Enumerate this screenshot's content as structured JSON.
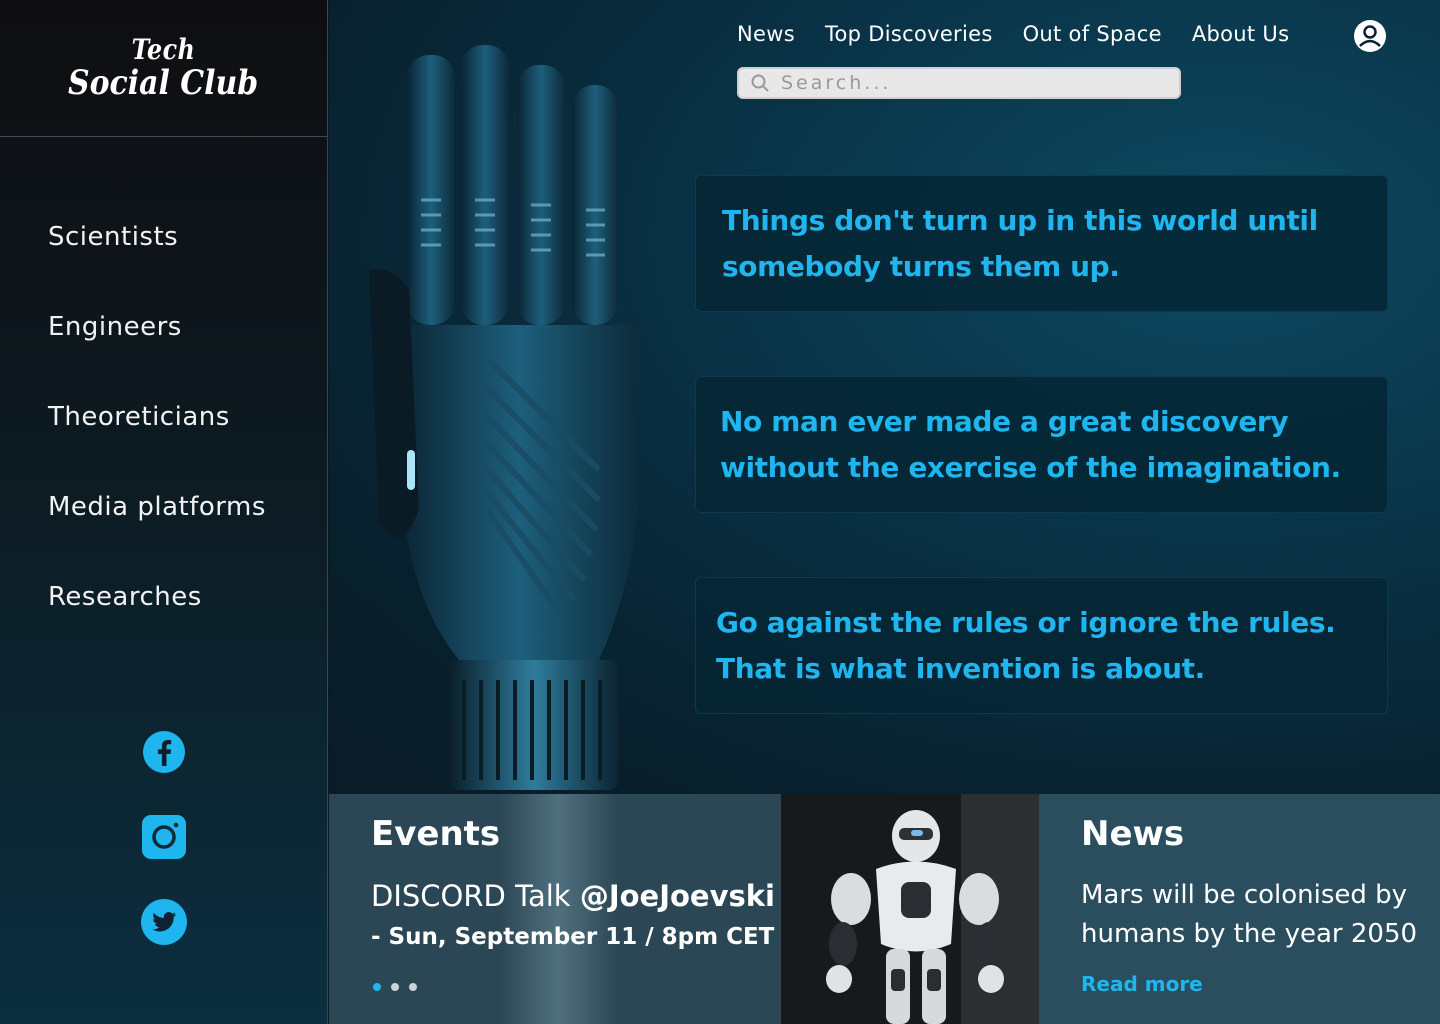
{
  "brand": {
    "line1": "Tech",
    "line2": "Social Club"
  },
  "sidebar": {
    "items": [
      {
        "label": "Scientists"
      },
      {
        "label": "Engineers"
      },
      {
        "label": "Theoreticians"
      },
      {
        "label": "Media platforms"
      },
      {
        "label": "Researches"
      }
    ],
    "socials": [
      "facebook-icon",
      "instagram-icon",
      "twitter-icon"
    ]
  },
  "topnav": {
    "items": [
      {
        "label": "News"
      },
      {
        "label": "Top Discoveries"
      },
      {
        "label": "Out of Space"
      },
      {
        "label": "About Us"
      }
    ]
  },
  "search": {
    "placeholder": "Search..."
  },
  "quotes": [
    {
      "text": "Things don't turn up in this world until somebody turns them up."
    },
    {
      "text": "No man ever made a great discovery without the exercise of the imagination."
    },
    {
      "text": "Go against the rules or ignore the rules. That is what invention is about."
    }
  ],
  "events": {
    "title": "Events",
    "line1_prefix": "DISCORD Talk ",
    "line1_handle": "@JoeJoevski",
    "line2": "- Sun, September 11 / 8pm CET"
  },
  "news": {
    "title": "News",
    "text": "Mars will be colonised by humans by the year 2050",
    "link": "Read more"
  },
  "colors": {
    "accent": "#1fb5ee",
    "sidebar_bg": "#0e0e10",
    "card_bg": "#052634"
  }
}
